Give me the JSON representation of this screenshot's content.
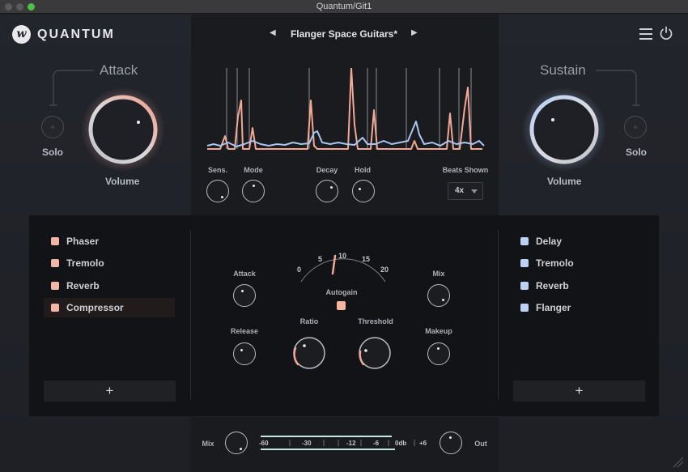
{
  "window": {
    "title": "Quantum/Git1"
  },
  "brand": {
    "logo_glyph": "w",
    "name": "QUANTUM"
  },
  "header": {
    "prev_arrow": "◀",
    "next_arrow": "▶",
    "preset_name": "Flanger Space Guitars*"
  },
  "left": {
    "section": "Attack",
    "solo_label": "Solo",
    "volume_label": "Volume"
  },
  "right": {
    "section": "Sustain",
    "solo_label": "Solo",
    "volume_label": "Volume"
  },
  "analyzer": {
    "knobs": {
      "sens": "Sens.",
      "mode": "Mode",
      "decay": "Decay",
      "hold": "Hold"
    },
    "beats_label": "Beats Shown",
    "beats_value": "4x"
  },
  "fx_left": {
    "items": [
      {
        "label": "Phaser",
        "selected": false
      },
      {
        "label": "Tremolo",
        "selected": false
      },
      {
        "label": "Reverb",
        "selected": false
      },
      {
        "label": "Compressor",
        "selected": true
      }
    ],
    "add_label": "+"
  },
  "fx_right": {
    "items": [
      {
        "label": "Delay"
      },
      {
        "label": "Tremolo"
      },
      {
        "label": "Reverb"
      },
      {
        "label": "Flanger"
      }
    ],
    "add_label": "+"
  },
  "compressor": {
    "attack": "Attack",
    "release": "Release",
    "ratio": "Ratio",
    "threshold": "Threshold",
    "mix": "Mix",
    "makeup": "Makeup",
    "autogain": "Autogain",
    "scale": [
      "0",
      "5",
      "10",
      "15",
      "20"
    ]
  },
  "footer": {
    "mix_label": "Mix",
    "out_label": "Out",
    "meter_ticks": [
      "-60",
      "-30",
      "-12",
      "-6",
      "0db",
      "+6"
    ]
  },
  "colors": {
    "accent_warm": "#f3a896",
    "accent_cool": "#a9c6ef",
    "panel": "#121316"
  }
}
